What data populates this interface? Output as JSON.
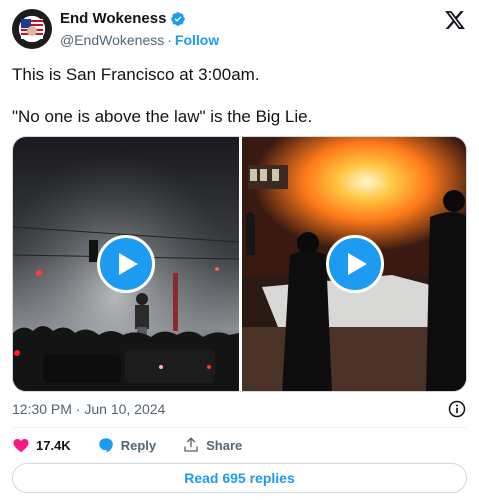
{
  "author": {
    "display_name": "End Wokeness",
    "handle": "@EndWokeness",
    "separator": "·",
    "follow_label": "Follow",
    "verified_color": "#1d9bf0"
  },
  "tweet": {
    "line1": "This is San Francisco at 3:00am.",
    "line2": "\"No one is above the law\" is the Big Lie."
  },
  "media": {
    "items": [
      {
        "kind": "video",
        "icon": "play-icon"
      },
      {
        "kind": "video",
        "icon": "play-icon"
      }
    ]
  },
  "timestamp": "12:30 PM · Jun 10, 2024",
  "actions": {
    "like_count": "17.4K",
    "reply_label": "Reply",
    "share_label": "Share"
  },
  "read_replies_label": "Read 695 replies",
  "colors": {
    "accent": "#1d9bf0",
    "like": "#f91880",
    "muted": "#536471"
  }
}
